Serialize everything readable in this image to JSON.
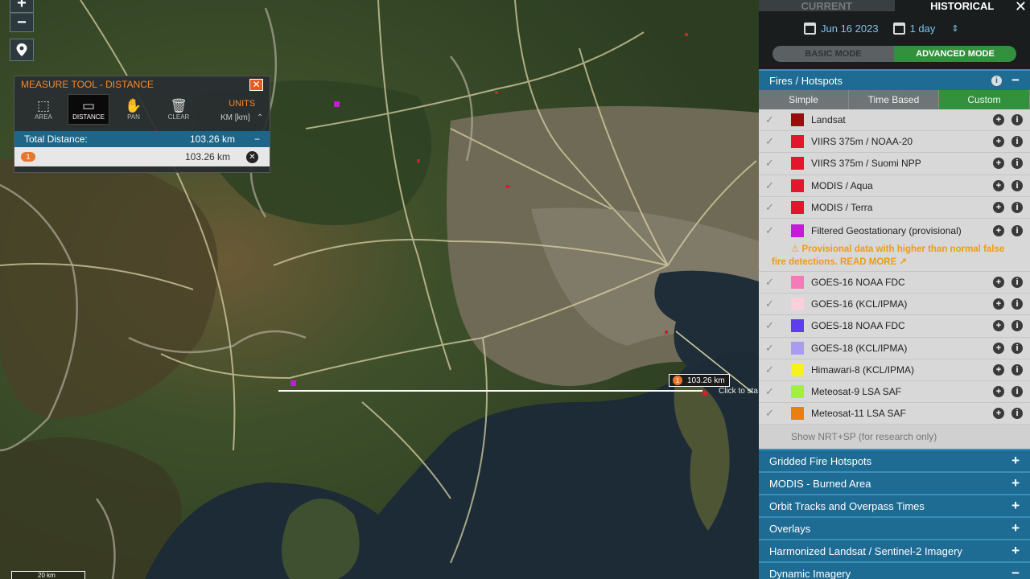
{
  "map": {
    "zoom_in": "+",
    "zoom_out": "−",
    "scale_label": "20 km",
    "line_label": {
      "index": "1",
      "distance": "103.26 km"
    },
    "click_hint": "Click to sta"
  },
  "measure": {
    "title": "MEASURE TOOL - DISTANCE",
    "close": "✕",
    "tools": [
      {
        "label": "AREA",
        "icon": "area-icon"
      },
      {
        "label": "DISTANCE",
        "icon": "ruler-icon"
      },
      {
        "label": "PAN",
        "icon": "hand-icon"
      },
      {
        "label": "CLEAR",
        "icon": "trash-icon"
      }
    ],
    "units_label": "UNITS",
    "units_value": "KM [km]",
    "total_label": "Total Distance:",
    "total_value": "103.26 km",
    "segments": [
      {
        "index": "1",
        "value": "103.26 km"
      }
    ]
  },
  "sidebar": {
    "tabs": {
      "current": "CURRENT",
      "historical": "HISTORICAL"
    },
    "date": "Jun 16 2023",
    "range": "1 day",
    "modes": {
      "basic": "BASIC MODE",
      "advanced": "ADVANCED MODE"
    },
    "fires_title": "Fires / Hotspots",
    "subtabs": [
      "Simple",
      "Time Based",
      "Custom"
    ],
    "layers": [
      {
        "name": "Landsat",
        "color": "#9b0d0d"
      },
      {
        "name": "VIIRS 375m / NOAA-20",
        "color": "#e2172d"
      },
      {
        "name": "VIIRS 375m / Suomi NPP",
        "color": "#e2172d"
      },
      {
        "name": "MODIS / Aqua",
        "color": "#e2172d"
      },
      {
        "name": "MODIS / Terra",
        "color": "#e2172d"
      }
    ],
    "geo_layer": {
      "name": "Filtered Geostationary (provisional)",
      "color": "#c51ad8",
      "warning_line1": "Provisional data with higher than normal false",
      "warning_line2": "fire detections. READ MORE"
    },
    "layers2": [
      {
        "name": "GOES-16 NOAA FDC",
        "color": "#f47ab8"
      },
      {
        "name": "GOES-16 (KCL/IPMA)",
        "color": "#fad0dc"
      },
      {
        "name": "GOES-18 NOAA FDC",
        "color": "#5c3ef0"
      },
      {
        "name": "GOES-18 (KCL/IPMA)",
        "color": "#a99af2"
      },
      {
        "name": "Himawari-8 (KCL/IPMA)",
        "color": "#f6f21b"
      },
      {
        "name": "Meteosat-9 LSA SAF",
        "color": "#a2ef40"
      },
      {
        "name": "Meteosat-11 LSA SAF",
        "color": "#ec7d10"
      }
    ],
    "nrt_label": "Show NRT+SP (for research only)",
    "sections": [
      {
        "label": "Gridded Fire Hotspots",
        "sign": "+"
      },
      {
        "label": "MODIS - Burned Area",
        "sign": "+"
      },
      {
        "label": "Orbit Tracks and Overpass Times",
        "sign": "+"
      },
      {
        "label": "Overlays",
        "sign": "+"
      },
      {
        "label": "Harmonized Landsat / Sentinel-2 Imagery",
        "sign": "+"
      },
      {
        "label": "Dynamic Imagery",
        "sign": "−"
      }
    ]
  }
}
